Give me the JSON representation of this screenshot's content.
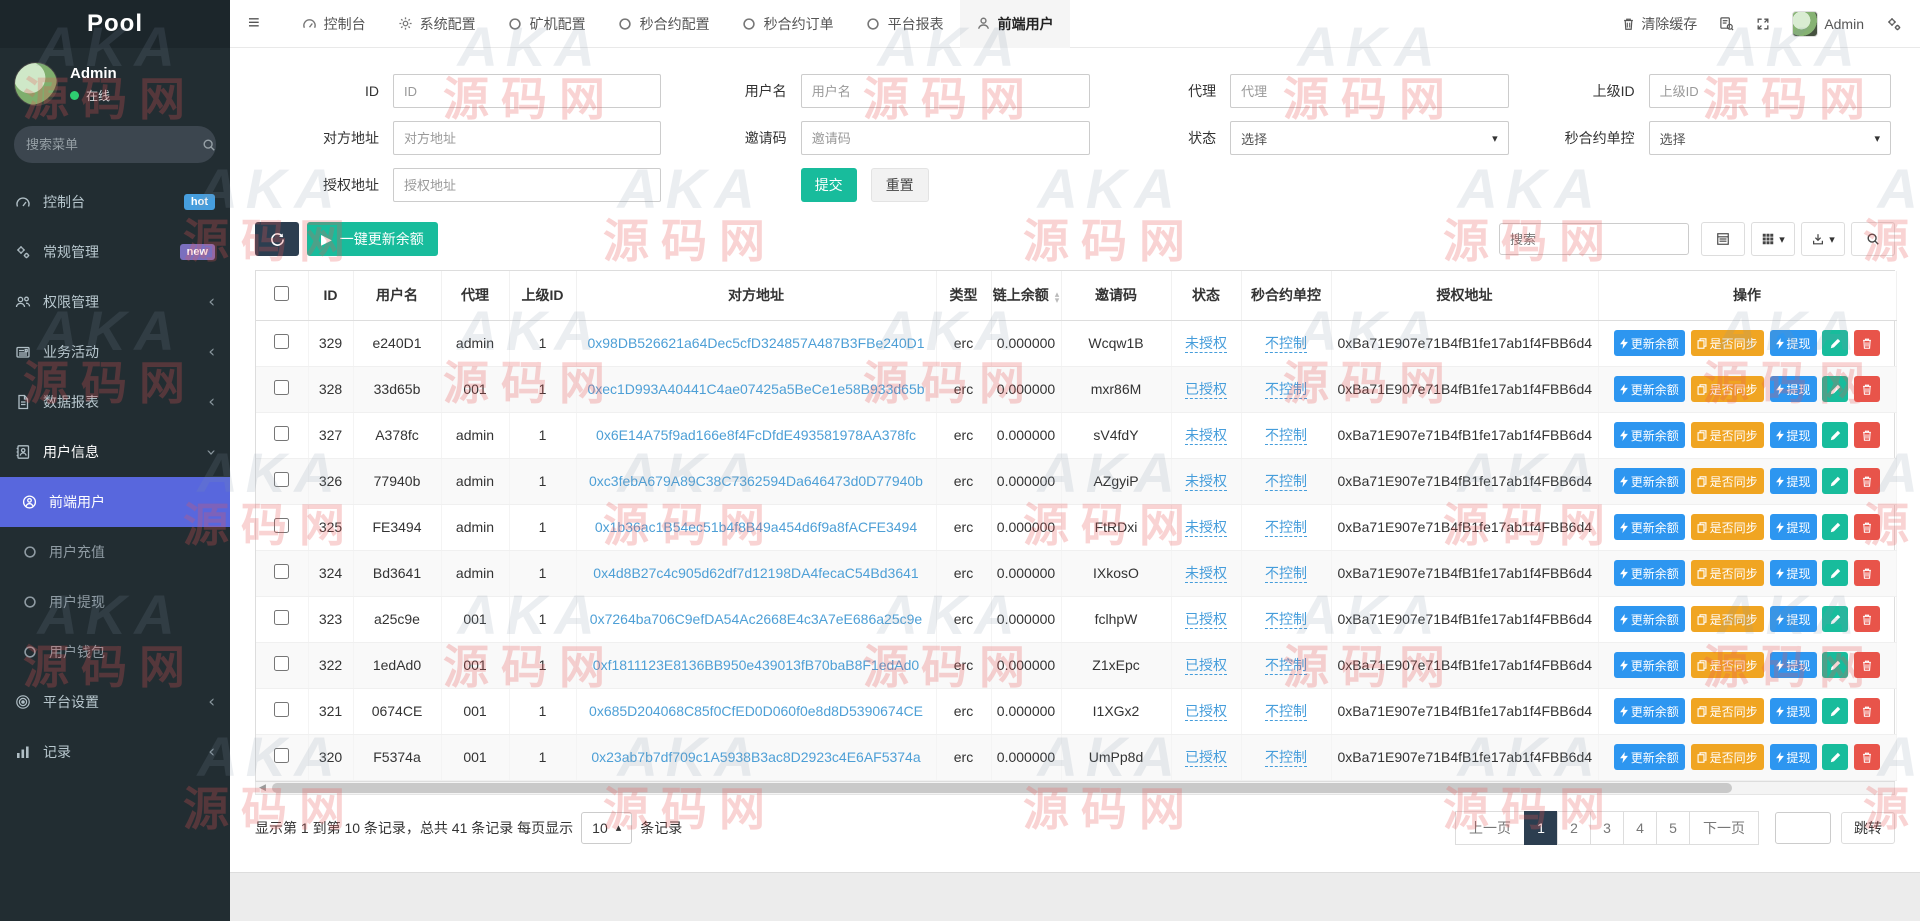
{
  "sidebar": {
    "logo": "Pool",
    "user": {
      "name": "Admin",
      "status": "在线"
    },
    "search_placeholder": "搜索菜单",
    "items": [
      {
        "label": "控制台",
        "badge": "hot"
      },
      {
        "label": "常规管理",
        "badge": "new"
      },
      {
        "label": "权限管理"
      },
      {
        "label": "业务活动"
      },
      {
        "label": "数据报表"
      },
      {
        "label": "用户信息"
      },
      {
        "label": "平台设置"
      },
      {
        "label": "记录"
      }
    ],
    "subitems": [
      {
        "label": "前端用户",
        "active": true
      },
      {
        "label": "用户充值"
      },
      {
        "label": "用户提现"
      },
      {
        "label": "用户钱包"
      }
    ]
  },
  "topnav": {
    "tabs": [
      {
        "label": "控制台"
      },
      {
        "label": "系统配置"
      },
      {
        "label": "矿机配置"
      },
      {
        "label": "秒合约配置"
      },
      {
        "label": "秒合约订单"
      },
      {
        "label": "平台报表"
      },
      {
        "label": "前端用户",
        "active": true
      }
    ],
    "clear_cache": "清除缓存",
    "user": "Admin"
  },
  "filters": {
    "id": {
      "label": "ID",
      "placeholder": "ID"
    },
    "username": {
      "label": "用户名",
      "placeholder": "用户名"
    },
    "agent": {
      "label": "代理",
      "placeholder": "代理"
    },
    "parent_id": {
      "label": "上级ID",
      "placeholder": "上级ID"
    },
    "address": {
      "label": "对方地址",
      "placeholder": "对方地址"
    },
    "invite_code": {
      "label": "邀请码",
      "placeholder": "邀请码"
    },
    "status": {
      "label": "状态",
      "value": "选择"
    },
    "contract_control": {
      "label": "秒合约单控",
      "value": "选择"
    },
    "auth_address": {
      "label": "授权地址",
      "placeholder": "授权地址"
    },
    "submit": "提交",
    "reset": "重置"
  },
  "toolbar": {
    "update_all": "一键更新余额",
    "search_placeholder": "搜索"
  },
  "table": {
    "columns": [
      "ID",
      "用户名",
      "代理",
      "上级ID",
      "对方地址",
      "类型",
      "链上余额",
      "邀请码",
      "状态",
      "秒合约单控",
      "授权地址",
      "操作"
    ],
    "actions": {
      "update": "更新余额",
      "sync": "是否同步",
      "withdraw": "提现"
    },
    "rows": [
      {
        "id": "329",
        "username": "e240D1",
        "agent": "admin",
        "parent": "1",
        "address": "0x98DB526621a64Dec5cfD324857A487B3FBe240D1",
        "type": "erc",
        "balance": "0.000000",
        "invite": "Wcqw1B",
        "status": "未授权",
        "control": "不控制",
        "auth": "0xBa71E907e71B4fB1fe17ab1f4FBB6d4"
      },
      {
        "id": "328",
        "username": "33d65b",
        "agent": "001",
        "parent": "1",
        "address": "0xec1D993A40441C4ae07425a5BeCe1e58B933d65b",
        "type": "erc",
        "balance": "0.000000",
        "invite": "mxr86M",
        "status": "已授权",
        "control": "不控制",
        "auth": "0xBa71E907e71B4fB1fe17ab1f4FBB6d4"
      },
      {
        "id": "327",
        "username": "A378fc",
        "agent": "admin",
        "parent": "1",
        "address": "0x6E14A75f9ad166e8f4FcDfdE493581978AA378fc",
        "type": "erc",
        "balance": "0.000000",
        "invite": "sV4fdY",
        "status": "未授权",
        "control": "不控制",
        "auth": "0xBa71E907e71B4fB1fe17ab1f4FBB6d4"
      },
      {
        "id": "326",
        "username": "77940b",
        "agent": "admin",
        "parent": "1",
        "address": "0xc3febA679A89C38C7362594Da646473d0D77940b",
        "type": "erc",
        "balance": "0.000000",
        "invite": "AZgyiP",
        "status": "未授权",
        "control": "不控制",
        "auth": "0xBa71E907e71B4fB1fe17ab1f4FBB6d4"
      },
      {
        "id": "325",
        "username": "FE3494",
        "agent": "admin",
        "parent": "1",
        "address": "0x1b36ac1B54ec51b4f8B49a454d6f9a8fACFE3494",
        "type": "erc",
        "balance": "0.000000",
        "invite": "FtRDxi",
        "status": "未授权",
        "control": "不控制",
        "auth": "0xBa71E907e71B4fB1fe17ab1f4FBB6d4"
      },
      {
        "id": "324",
        "username": "Bd3641",
        "agent": "admin",
        "parent": "1",
        "address": "0x4d8B27c4c905d62df7d12198DA4fecaC54Bd3641",
        "type": "erc",
        "balance": "0.000000",
        "invite": "IXkosO",
        "status": "未授权",
        "control": "不控制",
        "auth": "0xBa71E907e71B4fB1fe17ab1f4FBB6d4"
      },
      {
        "id": "323",
        "username": "a25c9e",
        "agent": "001",
        "parent": "1",
        "address": "0x7264ba706C9efDA54Ac2668E4c3A7eE686a25c9e",
        "type": "erc",
        "balance": "0.000000",
        "invite": "fclhpW",
        "status": "已授权",
        "control": "不控制",
        "auth": "0xBa71E907e71B4fB1fe17ab1f4FBB6d4"
      },
      {
        "id": "322",
        "username": "1edAd0",
        "agent": "001",
        "parent": "1",
        "address": "0xf1811123E8136BB950e439013fB70baB8F1edAd0",
        "type": "erc",
        "balance": "0.000000",
        "invite": "Z1xEpc",
        "status": "已授权",
        "control": "不控制",
        "auth": "0xBa71E907e71B4fB1fe17ab1f4FBB6d4"
      },
      {
        "id": "321",
        "username": "0674CE",
        "agent": "001",
        "parent": "1",
        "address": "0x685D204068C85f0CfED0D060f0e8d8D5390674CE",
        "type": "erc",
        "balance": "0.000000",
        "invite": "I1XGx2",
        "status": "已授权",
        "control": "不控制",
        "auth": "0xBa71E907e71B4fB1fe17ab1f4FBB6d4"
      },
      {
        "id": "320",
        "username": "F5374a",
        "agent": "001",
        "parent": "1",
        "address": "0x23ab7b7df709c1A5938B3ac8D2923c4E6AF5374a",
        "type": "erc",
        "balance": "0.000000",
        "invite": "UmPp8d",
        "status": "已授权",
        "control": "不控制",
        "auth": "0xBa71E907e71B4fB1fe17ab1f4FBB6d4"
      }
    ]
  },
  "pagination": {
    "summary": "显示第 1 到第 10 条记录，总共 41 条记录 每页显示",
    "page_size": "10",
    "suffix": "条记录",
    "prev": "上一页",
    "next": "下一页",
    "pages": [
      "1",
      "2",
      "3",
      "4",
      "5"
    ],
    "active_page": "1",
    "jump_label": "跳转"
  },
  "icons": {
    "hamburger": "≡",
    "play": "▶",
    "caret_down": "▾",
    "caret_up": "▴",
    "chevron": "‹",
    "sort_up": "▴",
    "sort_down": "▾",
    "scroll_arrow": "◀"
  },
  "colors": {
    "sidebar_bg": "#222d32",
    "active_menu": "#5867dd",
    "primary_dark": "#2c3e50",
    "green": "#18bc9c",
    "blue": "#2d96f0",
    "orange": "#f0a522",
    "red": "#e8544a",
    "link_blue": "#4d9fd6",
    "badge_hot": "#469ede",
    "badge_new": "#7a6fbe",
    "watermark_red": "#e65555"
  },
  "watermark": {
    "brand": "AKA",
    "text": "源码网"
  }
}
